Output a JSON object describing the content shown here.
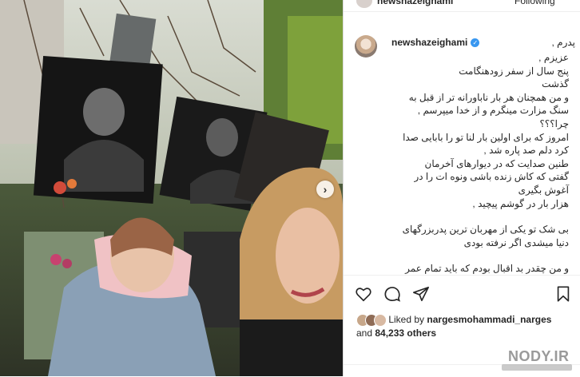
{
  "header": {
    "username": "newshazeighami",
    "follow_label": "Following"
  },
  "post": {
    "username": "newshazeighami",
    "caption_first": "پدرم ,",
    "caption_lines": [
      "عزیزم ,",
      "پنج سال از سفر زودهنگامت",
      "گذشت",
      "و من همچنان هر بار ناباورانه تر از قبل به",
      "سنگ مزارت مینگرم و از خدا میپرسم ,",
      "چرا؟؟؟",
      "امروز که برای اولین بار لنا تو را بابایی صدا",
      "کرد دلم صد پاره شد ,",
      "طنین صدایت که در دیوارهای آخرمان",
      "گفتی که کاش زنده باشی ونوه ات را در",
      "آغوش بگیری",
      "هزار بار در گوشم پیچید ,",
      "",
      "بی شک تو یکی از مهربان ترین پدربزرگهای",
      "دنیا میشدی اگر نرفته بودی",
      "",
      "و من چقدر بد اقبال بودم که باید تمام عمر"
    ]
  },
  "likes": {
    "prefix": "Liked by",
    "user": "nargesmohammadi_narges",
    "middle": "and",
    "count": "84,233 others"
  },
  "watermark": "NODY.IR",
  "icons": {
    "heart": "heart-icon",
    "comment": "comment-icon",
    "share": "share-icon",
    "save": "bookmark-icon",
    "next": "chevron-right-icon"
  },
  "colors": {
    "verified": "#3897f0",
    "text": "#262626"
  }
}
